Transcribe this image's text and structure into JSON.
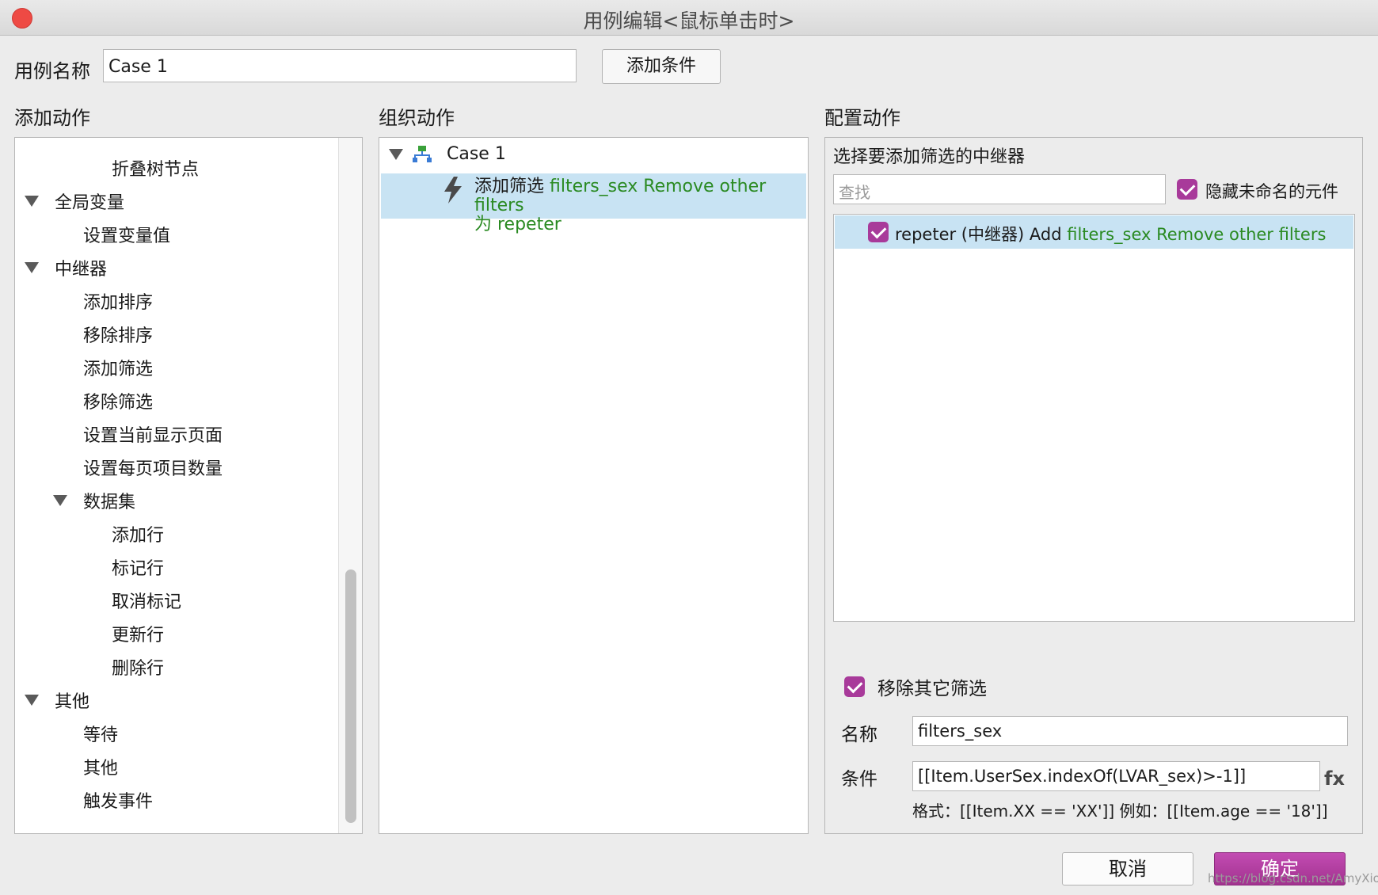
{
  "window": {
    "title": "用例编辑<鼠标单击时>"
  },
  "case_name": {
    "label": "用例名称",
    "value": "Case 1",
    "add_condition_label": "添加条件"
  },
  "sections": {
    "add_actions": "添加动作",
    "organize_actions": "组织动作",
    "configure_actions": "配置动作"
  },
  "action_tree": [
    {
      "label": "折叠树节点",
      "level": 2,
      "expandable": false
    },
    {
      "label": "全局变量",
      "level": 0,
      "expandable": true
    },
    {
      "label": "设置变量值",
      "level": 1,
      "expandable": false
    },
    {
      "label": "中继器",
      "level": 0,
      "expandable": true
    },
    {
      "label": "添加排序",
      "level": 1,
      "expandable": false
    },
    {
      "label": "移除排序",
      "level": 1,
      "expandable": false
    },
    {
      "label": "添加筛选",
      "level": 1,
      "expandable": false
    },
    {
      "label": "移除筛选",
      "level": 1,
      "expandable": false
    },
    {
      "label": "设置当前显示页面",
      "level": 1,
      "expandable": false
    },
    {
      "label": "设置每页项目数量",
      "level": 1,
      "expandable": false
    },
    {
      "label": "数据集",
      "level": 1,
      "expandable": true
    },
    {
      "label": "添加行",
      "level": 2,
      "expandable": false
    },
    {
      "label": "标记行",
      "level": 2,
      "expandable": false
    },
    {
      "label": "取消标记",
      "level": 2,
      "expandable": false
    },
    {
      "label": "更新行",
      "level": 2,
      "expandable": false
    },
    {
      "label": "删除行",
      "level": 2,
      "expandable": false
    },
    {
      "label": "其他",
      "level": 0,
      "expandable": true
    },
    {
      "label": "等待",
      "level": 1,
      "expandable": false
    },
    {
      "label": "其他",
      "level": 1,
      "expandable": false
    },
    {
      "label": "触发事件",
      "level": 1,
      "expandable": false
    }
  ],
  "organize": {
    "case_label": "Case 1",
    "action_prefix": "添加筛选",
    "action_green_1": "filters_sex Remove other filters",
    "action_line2_green": "为 repeter"
  },
  "configure": {
    "select_title": "选择要添加筛选的中继器",
    "search_placeholder": "查找",
    "hide_unnamed_label": "隐藏未命名的元件",
    "repeater_row_prefix": "repeter (中继器) Add",
    "repeater_row_green": "filters_sex Remove other filters",
    "remove_other_filters_label": "移除其它筛选",
    "name_label": "名称",
    "name_value": "filters_sex",
    "condition_label": "条件",
    "condition_value": "[[Item.UserSex.indexOf(LVAR_sex)>-1]]",
    "fx_label": "fx",
    "format_hint": "格式：[[Item.XX == 'XX']] 例如：[[Item.age == '18']]"
  },
  "footer": {
    "cancel_label": "取消",
    "ok_label": "确定",
    "watermark": "https://blog.csdn.net/AmyXiom"
  },
  "colors": {
    "accent_purple": "#a83a9a",
    "selection_blue": "#c8e3f3",
    "green_text": "#2a8a22",
    "close_red": "#ee4a44"
  },
  "icons": {
    "case_node": "org-chart-icon",
    "action": "lightning-bolt-icon",
    "checkbox": "checkbox-checked-icon"
  }
}
